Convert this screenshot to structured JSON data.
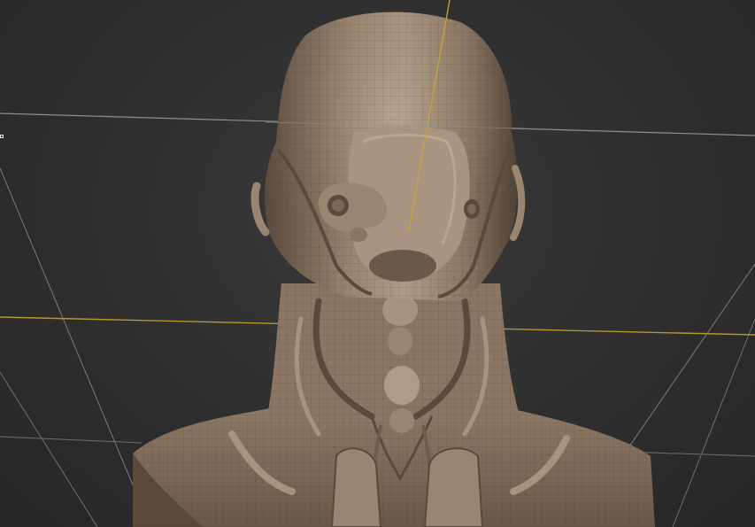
{
  "viewport": {
    "background_color": "#2e2e2e",
    "grid_color": "#8a8a8a",
    "axis_x_color": "#b8962e",
    "axis_z_color": "#c9a636",
    "model_color": "#8a7662",
    "model_highlight_color": "#b3a08a",
    "model_shadow_color": "#4a3c30"
  }
}
